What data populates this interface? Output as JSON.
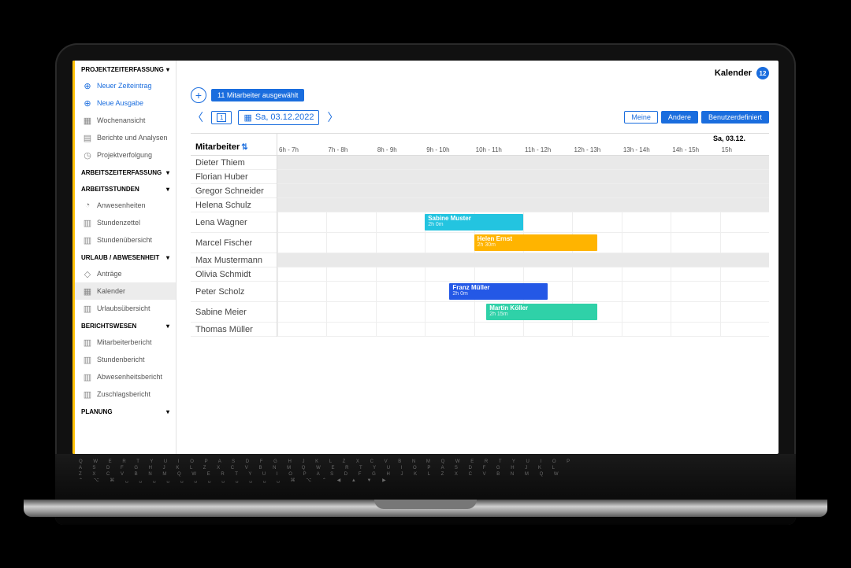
{
  "header": {
    "title": "Kalender",
    "count": "12"
  },
  "toolbar": {
    "selection_pill": "11 Mitarbeiter ausgewählt",
    "date": "Sa, 03.12.2022",
    "today_btn_glyph": "1",
    "filters": {
      "mine": "Meine",
      "others": "Andere",
      "custom": "Benutzerdefiniert"
    }
  },
  "day_label": "Sa, 03.12.",
  "hours": [
    "6h - 7h",
    "7h - 8h",
    "8h - 9h",
    "9h - 10h",
    "10h - 11h",
    "11h - 12h",
    "12h - 13h",
    "13h - 14h",
    "14h - 15h",
    "15h"
  ],
  "emp_header": "Mitarbeiter",
  "employees": [
    {
      "name": "Dieter Thiem",
      "shade": true
    },
    {
      "name": "Florian Huber",
      "shade": true
    },
    {
      "name": "Gregor Schneider",
      "shade": true
    },
    {
      "name": "Helena Schulz",
      "shade": true
    },
    {
      "name": "Lena Wagner",
      "shade": false,
      "tall": true,
      "bar": {
        "label": "Sabine Muster",
        "dur": "2h 0m",
        "color": "#23c4e0",
        "start": 3.0,
        "len": 2.0
      }
    },
    {
      "name": "Marcel Fischer",
      "shade": false,
      "tall": true,
      "bar": {
        "label": "Helen Ernst",
        "dur": "2h 30m",
        "color": "#ffb400",
        "start": 4.0,
        "len": 2.5
      }
    },
    {
      "name": "Max Mustermann",
      "shade": true
    },
    {
      "name": "Olivia Schmidt",
      "shade": false
    },
    {
      "name": "Peter Scholz",
      "shade": false,
      "tall": true,
      "bar": {
        "label": "Franz Müller",
        "dur": "2h 0m",
        "color": "#2458e6",
        "start": 3.5,
        "len": 2.0
      }
    },
    {
      "name": "Sabine Meier",
      "shade": false,
      "tall": true,
      "bar": {
        "label": "Martin Köller",
        "dur": "2h 15m",
        "color": "#2fd1a8",
        "start": 4.25,
        "len": 2.25
      }
    },
    {
      "name": "Thomas Müller",
      "shade": false
    }
  ],
  "sidebar": {
    "s1": {
      "title": "PROJEKTZEITERFASSUNG",
      "new_entry": "Neuer Zeiteintrag",
      "new_expense": "Neue Ausgabe",
      "week_view": "Wochenansicht",
      "reports": "Berichte und Analysen",
      "tracking": "Projektverfolgung"
    },
    "s2": {
      "title": "ARBEITSZEITERFASSUNG"
    },
    "s3": {
      "title": "ARBEITSSTUNDEN",
      "presences": "Anwesenheiten",
      "timesheet": "Stundenzettel",
      "hours_overview": "Stundenübersicht"
    },
    "s4": {
      "title": "URLAUB / ABWESENHEIT",
      "requests": "Anträge",
      "calendar": "Kalender",
      "leave_overview": "Urlaubsübersicht"
    },
    "s5": {
      "title": "BERICHTSWESEN",
      "emp_report": "Mitarbeiterbericht",
      "hours_report": "Stundenbericht",
      "absence_report": "Abwesenheitsbericht",
      "surcharge_report": "Zuschlagsbericht"
    },
    "s6": {
      "title": "PLANUNG"
    }
  }
}
